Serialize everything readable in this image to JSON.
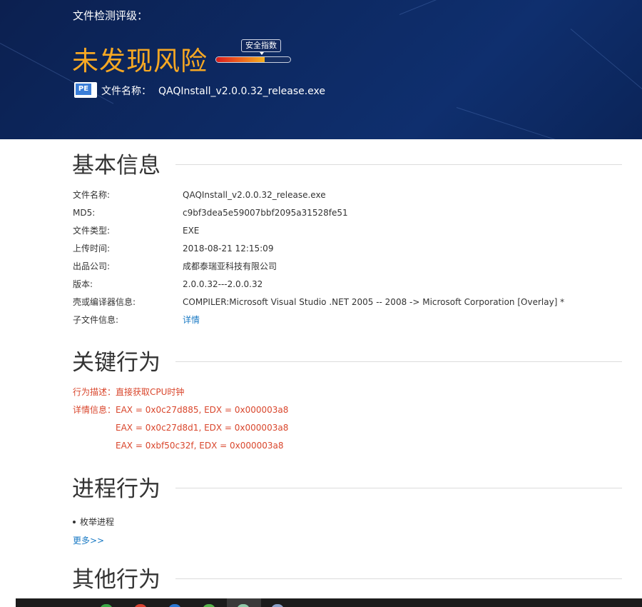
{
  "hero": {
    "title": "文件检测评级：",
    "risk_label": "未发现风险",
    "safety_badge": "安全指数",
    "safety_level": 0.65,
    "file_label": "文件名称：",
    "file_name": "QAQInstall_v2.0.0.32_release.exe",
    "file_icon": "PE"
  },
  "basic": {
    "title": "基本信息",
    "rows": [
      {
        "label": "文件名称:",
        "value": "QAQInstall_v2.0.0.32_release.exe"
      },
      {
        "label": "MD5:",
        "value": "c9bf3dea5e59007bbf2095a31528fe51"
      },
      {
        "label": "文件类型:",
        "value": "EXE"
      },
      {
        "label": "上传时间:",
        "value": "2018-08-21 12:15:09"
      },
      {
        "label": "出品公司:",
        "value": "成都泰瑞亚科技有限公司"
      },
      {
        "label": "版本:",
        "value": "2.0.0.32---2.0.0.32"
      },
      {
        "label": "壳或编译器信息:",
        "value": "COMPILER:Microsoft Visual Studio .NET 2005 -- 2008 -> Microsoft Corporation [Overlay] *"
      },
      {
        "label": "子文件信息:",
        "value": "详情"
      }
    ]
  },
  "key": {
    "title": "关键行为",
    "desc_label": "行为描述：",
    "desc_value": "直接获取CPU时钟",
    "detail_label": "详情信息：",
    "details": [
      "EAX = 0x0c27d885, EDX = 0x000003a8",
      "EAX = 0x0c27d8d1, EDX = 0x000003a8",
      "EAX = 0xbf50c32f, EDX = 0x000003a8"
    ]
  },
  "process": {
    "title": "进程行为",
    "items": [
      "枚举进程"
    ],
    "more": "更多>>"
  },
  "other": {
    "title": "其他行为"
  },
  "colors": {
    "hero_bg": "#0d2a64",
    "risk": "#f7a823",
    "alert": "#d9462c",
    "link": "#1a7ac4"
  }
}
